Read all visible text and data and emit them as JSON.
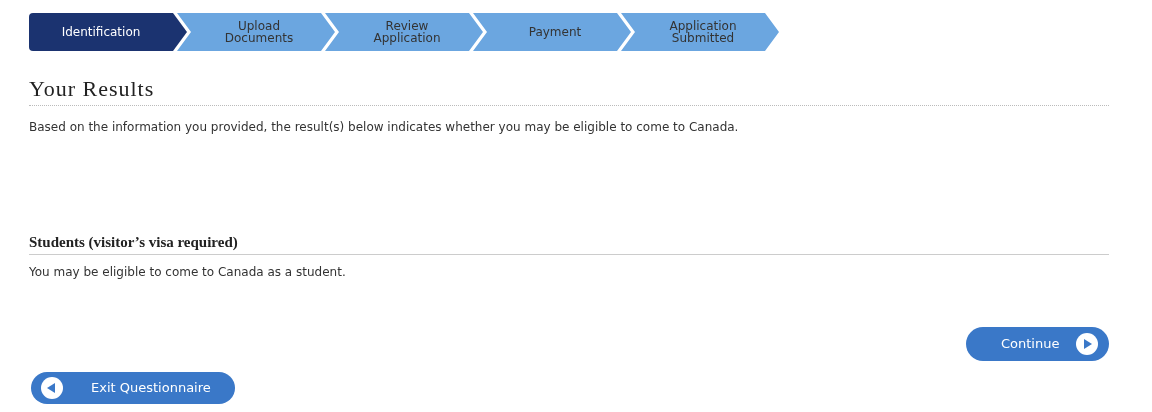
{
  "steps": [
    {
      "label": "Identification",
      "selected": true
    },
    {
      "label": "Upload\nDocuments",
      "selected": false
    },
    {
      "label": "Review\nApplication",
      "selected": false
    },
    {
      "label": "Payment",
      "selected": false
    },
    {
      "label": "Application\nSubmitted",
      "selected": false
    }
  ],
  "title": "Your Results",
  "intro": "Based on the information you provided, the result(s) below indicates whether you may be eligible to come to Canada.",
  "result": {
    "heading": "Students (visitor’s visa required)",
    "text": "You may be eligible to come to Canada as a student."
  },
  "continue_button": "Continue",
  "exit_button": "Exit Questionnaire"
}
